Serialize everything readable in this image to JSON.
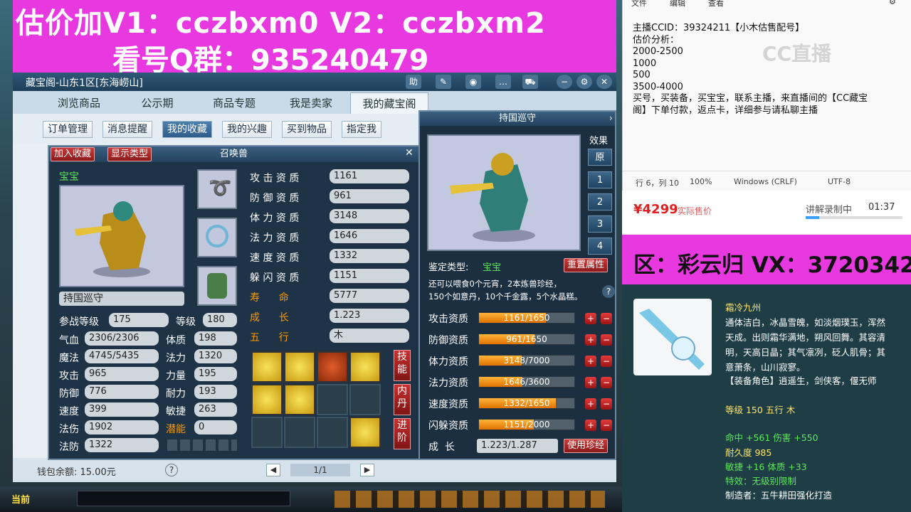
{
  "banner": {
    "line1": "估价加V1：cczbxm0    V2：cczbxm2",
    "line2": "看号Q群：935240479"
  },
  "window": {
    "title": "藏宝阁-山东1区[东海崂山]",
    "help_label": "助",
    "nav_tabs": [
      "浏览商品",
      "公示期",
      "商品专题",
      "我是卖家",
      "我的藏宝阁"
    ],
    "sub_tabs": [
      "订单管理",
      "消息提醒",
      "我的收藏",
      "我的兴趣",
      "买到物品",
      "指定我"
    ],
    "wallet_label": "钱包余额: 15.00元",
    "page_indicator": "1/1"
  },
  "summon": {
    "title": "召唤兽",
    "fav_button": "加入收藏",
    "type_button": "显示类型",
    "pet_type": "宝宝",
    "pet_name": "持国巡守",
    "level_labels": {
      "battle": "参战等级",
      "level": "等级"
    },
    "battle_level": "175",
    "level": "180",
    "left_stats": [
      {
        "label": "气血",
        "value": "2306/2306"
      },
      {
        "label": "魔法",
        "value": "4745/5435"
      },
      {
        "label": "攻击",
        "value": "965"
      },
      {
        "label": "防御",
        "value": "776"
      },
      {
        "label": "速度",
        "value": "399"
      },
      {
        "label": "法伤",
        "value": "1902"
      },
      {
        "label": "法防",
        "value": "1322"
      }
    ],
    "mid_stats": [
      {
        "label": "体质",
        "value": "198"
      },
      {
        "label": "法力",
        "value": "1320"
      },
      {
        "label": "力量",
        "value": "195"
      },
      {
        "label": "耐力",
        "value": "193"
      },
      {
        "label": "敏捷",
        "value": "263"
      },
      {
        "label": "潜能",
        "value": "0"
      }
    ],
    "aptitudes": [
      {
        "label": "攻 击 资 质",
        "value": "1161"
      },
      {
        "label": "防 御 资 质",
        "value": "961"
      },
      {
        "label": "体 力 资 质",
        "value": "3148"
      },
      {
        "label": "法 力 资 质",
        "value": "1646"
      },
      {
        "label": "速 度 资 质",
        "value": "1332"
      },
      {
        "label": "躲 闪 资 质",
        "value": "1151"
      },
      {
        "label": "寿      命",
        "value": "5777"
      },
      {
        "label": "成      长",
        "value": "1.223"
      },
      {
        "label": "五      行",
        "value": "木"
      }
    ],
    "side_tabs": [
      "技能",
      "内丹",
      "进阶"
    ]
  },
  "pet_panel": {
    "title": "持国巡守",
    "effect_label": "效果",
    "effect_buttons": [
      "原",
      "1",
      "2",
      "3",
      "4"
    ],
    "appraise_label": "鉴定类型:",
    "appraise_value": "宝宝",
    "reset_button": "重置属性",
    "feed_line1": "还可以喂食0个元宵，2本炼兽珍经，",
    "feed_line2": "150个如意丹，10个千金露，5个水晶糕。",
    "bars": [
      {
        "label": "攻击资质",
        "text": "1161/1650",
        "fraction": 0.7036
      },
      {
        "label": "防御资质",
        "text": "961/1650",
        "fraction": 0.5824
      },
      {
        "label": "体力资质",
        "text": "3148/7000",
        "fraction": 0.4497
      },
      {
        "label": "法力资质",
        "text": "1646/3600",
        "fraction": 0.4572
      },
      {
        "label": "速度资质",
        "text": "1332/1650",
        "fraction": 0.8073
      },
      {
        "label": "闪躲资质",
        "text": "1151/2000",
        "fraction": 0.5755
      }
    ],
    "growth_label": "成  长",
    "growth_value": "1.223/1.287",
    "use_button": "使用珍经"
  },
  "notepad": {
    "menu": [
      "文件",
      "编辑",
      "查看"
    ],
    "lines": [
      "主播CCID：39324211【小木估售配号】",
      "估价分析：",
      "2000-2500",
      "1000",
      "500",
      "3500-4000",
      "买号，买装备，买宝宝，联系主播，来直播间的【CC藏宝",
      "阁】下单付款，返点卡，详细参与请私聊主播"
    ],
    "status": {
      "position": "行 6，列 10",
      "zoom": "100%",
      "eol": "Windows (CRLF)",
      "encoding": "UTF-8"
    },
    "watermark": "CC直播"
  },
  "price_strip": {
    "price": "¥4299",
    "price_note": "实际售价",
    "recording": "讲解录制中",
    "time": "01:37"
  },
  "vx_banner": "区：彩云归  VX：3720342",
  "item_card": {
    "name": "霜冷九州",
    "desc": [
      "通体洁白，冰晶雪魄，如淡烟璞玉，浑然",
      "天成。出则霜华满地，朔风回舞。其容清",
      "明，天高日晶；其气凛冽，砭人肌骨；其",
      "意萧条，山川寂寥。"
    ],
    "roles": "【装备角色】逍遥生，剑侠客，偃无师",
    "level_line": "等级 150  五行 木",
    "stat1": "命中 +561  伤害 +550",
    "durability": "耐久度 985",
    "stat2": "敏捷 +16  体质 +33",
    "special": "特效：无级别限制",
    "maker": "制造者：五牛耕田强化打造"
  },
  "bottom": {
    "current_label": "当前"
  }
}
